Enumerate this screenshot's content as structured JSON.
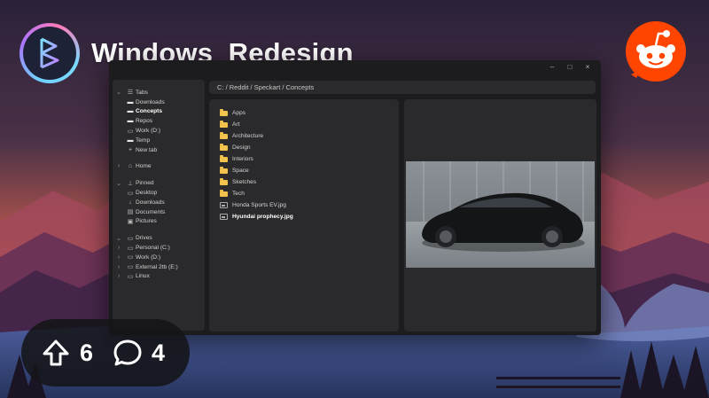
{
  "community": {
    "name": "Windows_Redesign",
    "logo_icon": "community-logo-icon",
    "platform_icon": "reddit-icon"
  },
  "window": {
    "controls": {
      "minimize": "–",
      "maximize": "□",
      "close": "×"
    },
    "address_path": "C: / Reddit / Speckart / Concepts",
    "sidebar": {
      "groups": [
        {
          "label": "Tabs",
          "icon": "tabs-icon",
          "items": [
            {
              "label": "Downloads",
              "icon": "folder-icon"
            },
            {
              "label": "Concepts",
              "icon": "folder-icon",
              "active": true
            },
            {
              "label": "Repos",
              "icon": "folder-icon"
            },
            {
              "label": "Work (D:)",
              "icon": "drive-icon"
            },
            {
              "label": "Temp",
              "icon": "folder-icon"
            },
            {
              "label": "New tab",
              "icon": "plus-icon"
            }
          ]
        },
        {
          "label": "Home",
          "icon": "home-icon",
          "items": []
        },
        {
          "label": "Pinned",
          "icon": "pin-icon",
          "items": [
            {
              "label": "Desktop",
              "icon": "desktop-icon"
            },
            {
              "label": "Downloads",
              "icon": "download-icon"
            },
            {
              "label": "Documents",
              "icon": "documents-icon"
            },
            {
              "label": "Pictures",
              "icon": "pictures-icon"
            }
          ]
        },
        {
          "label": "Drives",
          "icon": "drives-icon",
          "items": [
            {
              "label": "Personal (C:)",
              "icon": "drive-icon"
            },
            {
              "label": "Work (D:)",
              "icon": "drive-icon"
            },
            {
              "label": "External 2tb (E:)",
              "icon": "drive-icon"
            },
            {
              "label": "Linux",
              "icon": "drive-icon"
            }
          ]
        }
      ]
    },
    "files": [
      {
        "name": "Apps",
        "type": "folder"
      },
      {
        "name": "Art",
        "type": "folder"
      },
      {
        "name": "Architecture",
        "type": "folder"
      },
      {
        "name": "Design",
        "type": "folder"
      },
      {
        "name": "Interiors",
        "type": "folder"
      },
      {
        "name": "Space",
        "type": "folder"
      },
      {
        "name": "Sketches",
        "type": "folder"
      },
      {
        "name": "Tech",
        "type": "folder"
      },
      {
        "name": "Honda Sports EV.jpg",
        "type": "image"
      },
      {
        "name": "Hyundai prophecy.jpg",
        "type": "image",
        "selected": true
      }
    ],
    "preview_icon": "car-preview-image"
  },
  "stats": {
    "upvotes": "6",
    "comments": "4"
  },
  "colors": {
    "folder": "#f2c34c",
    "reddit_orange": "#ff4500",
    "window_bg": "#1c1c1e",
    "pane_bg": "#2a2a2c"
  }
}
